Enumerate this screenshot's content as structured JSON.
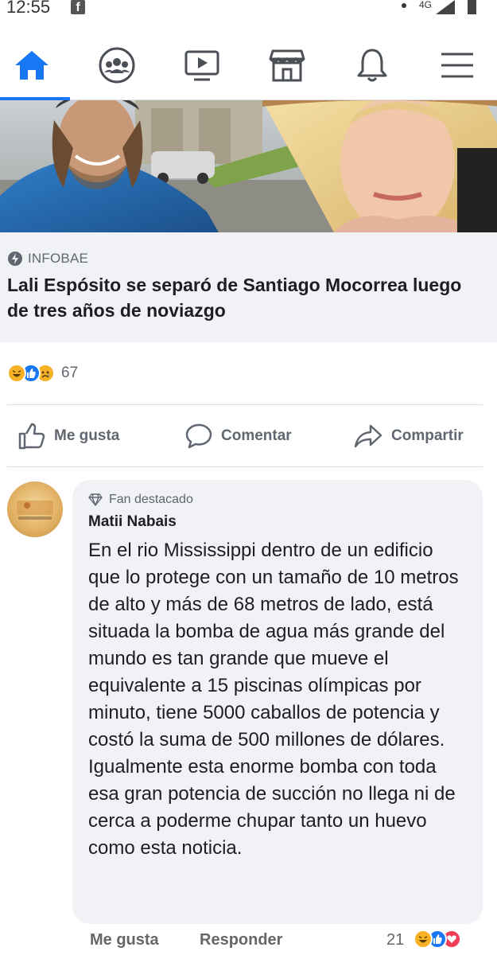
{
  "status_bar": {
    "time": "12:55",
    "network": "4G"
  },
  "nav": {
    "tabs": [
      "home-icon",
      "groups-icon",
      "watch-icon",
      "marketplace-icon",
      "notifications-icon",
      "menu-icon"
    ],
    "active_color": "#1877f2"
  },
  "post": {
    "source": "INFOBAE",
    "headline": "Lali Espósito se separó de Santiago Mocorrea luego de tres años de noviazgo",
    "reaction_count": "67",
    "actions": {
      "like": "Me gusta",
      "comment": "Comentar",
      "share": "Compartir"
    }
  },
  "comment": {
    "badge": "Fan destacado",
    "author": "Matii Nabais",
    "text": "En el rio Mississippi dentro de un edificio que lo protege con un tamaño de 10 metros de alto y más de 68 metros de lado, está situada la bomba de agua más grande del mundo es tan grande que mueve el equivalente a 15 piscinas olímpicas por minuto, tiene 5000 caballos de potencia y costó la suma de 500 millones de dólares. Igualmente esta enorme bomba con toda esa gran potencia de succión no llega ni de cerca a poderme chupar tanto un huevo como esta noticia.",
    "like_label": "Me gusta",
    "reply_label": "Responder",
    "reaction_count": "21"
  }
}
